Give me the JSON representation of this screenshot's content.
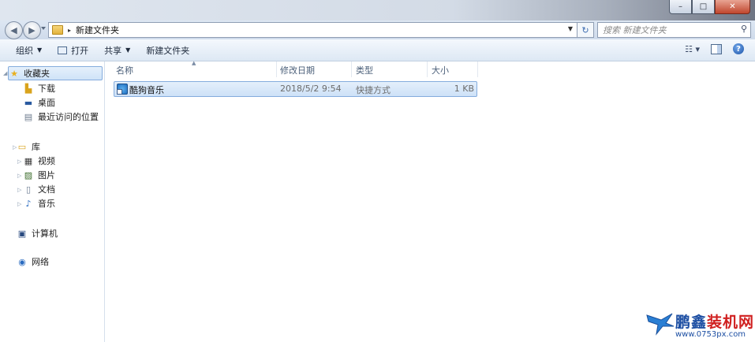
{
  "window": {
    "controls": [
      "–",
      "□",
      "✕"
    ]
  },
  "address": {
    "path": "新建文件夹",
    "arrow": "▸"
  },
  "search": {
    "placeholder": "搜索 新建文件夹"
  },
  "toolbar": {
    "organize_label": "组织",
    "open_label": "打开",
    "share_label": "共享",
    "new_folder_label": "新建文件夹"
  },
  "navpane": {
    "favorites": {
      "label": "收藏夹",
      "items": [
        "下载",
        "桌面",
        "最近访问的位置"
      ]
    },
    "libraries": {
      "label": "库",
      "items": [
        "视频",
        "图片",
        "文档",
        "音乐"
      ]
    },
    "computer": "计算机",
    "network": "网络"
  },
  "columns": {
    "name": "名称",
    "date": "修改日期",
    "type": "类型",
    "size": "大小"
  },
  "files": [
    {
      "name": "酷狗音乐",
      "date": "2018/5/2 9:54",
      "type": "快捷方式",
      "size": "1 KB"
    }
  ],
  "watermark": {
    "brand_part1": "鹏鑫",
    "brand_part2": "装机网",
    "url": "www.0753px.com"
  },
  "colors": {
    "accent": "#3b78c4",
    "selection": "#cde1f7",
    "watermark_blue": "#1d4fa3",
    "watermark_red": "#d02020"
  }
}
